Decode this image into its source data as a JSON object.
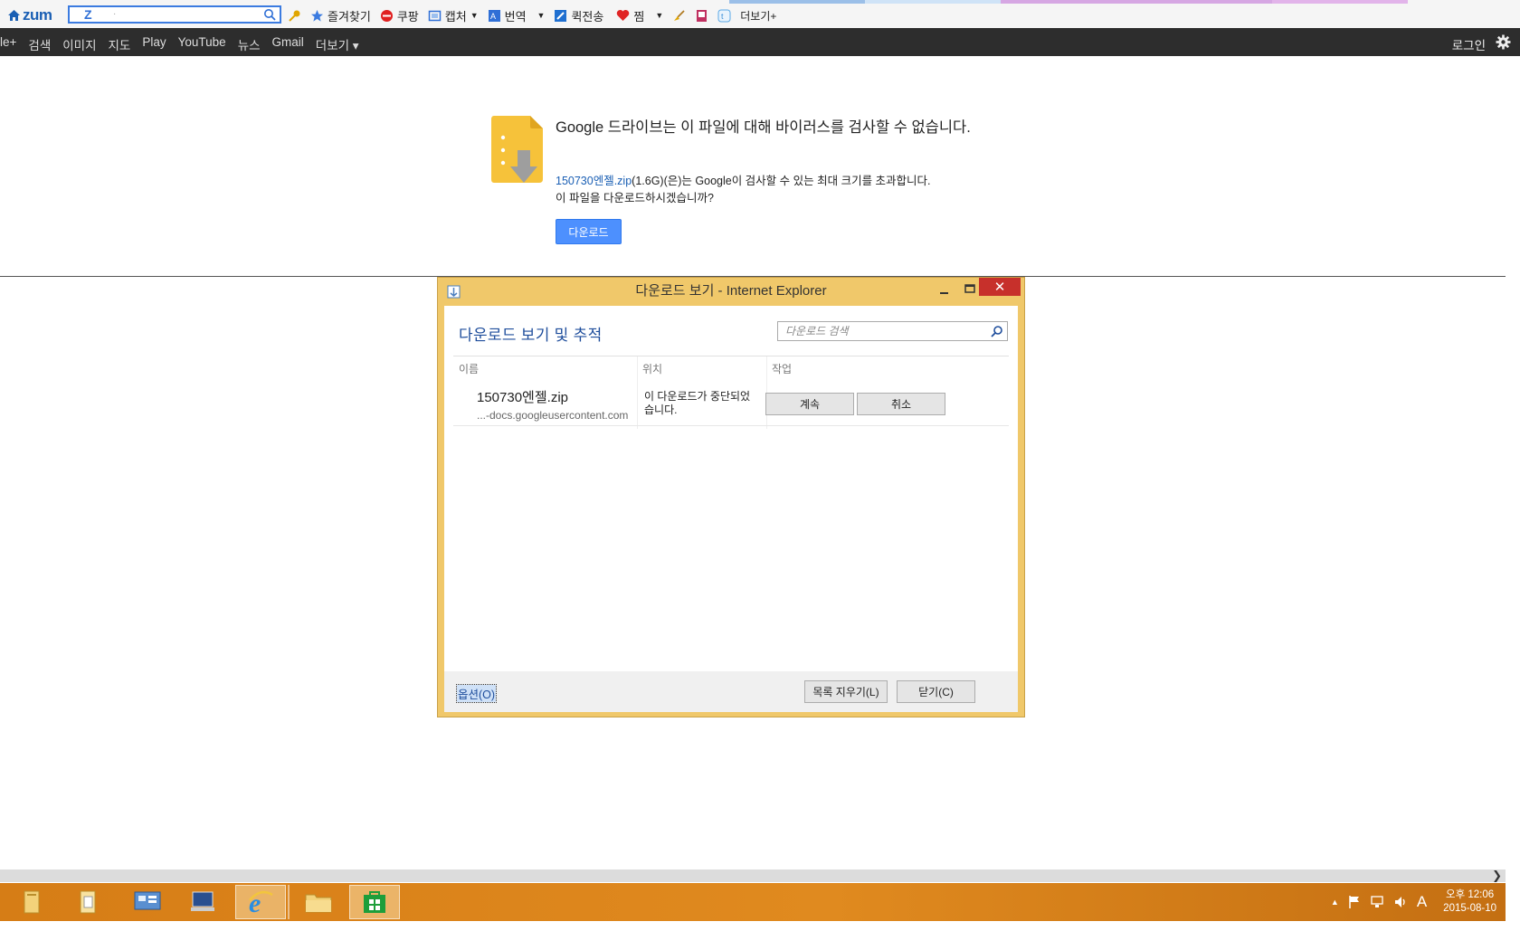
{
  "zum_toolbar": {
    "logo": "zum",
    "search_value": "·",
    "tools": [
      {
        "label": "즐겨찾기",
        "icon": "star-icon"
      },
      {
        "label": "쿠팡",
        "icon": "coupang-icon"
      },
      {
        "label": "캡처",
        "icon": "capture-icon"
      },
      {
        "label": "번역",
        "icon": "translate-icon"
      },
      {
        "label": "퀵전송",
        "icon": "quick-send-icon"
      },
      {
        "label": "찜",
        "icon": "heart-icon"
      }
    ],
    "more_label": "더보기+"
  },
  "google_bar": {
    "links": [
      "le+",
      "검색",
      "이미지",
      "지도",
      "Play",
      "YouTube",
      "뉴스",
      "Gmail",
      "더보기 ▾"
    ],
    "login_label": "로그인"
  },
  "drive_warning": {
    "title": "Google 드라이브는 이 파일에 대해 바이러스를 검사할 수 없습니다.",
    "file_name": "150730엔젤.zip",
    "desc_rest": "(1.6G)(은)는 Google이 검사할 수 있는 최대 크기를 초과합니다.",
    "question": "이 파일을 다운로드하시겠습니까?",
    "download_button": "다운로드"
  },
  "download_dialog": {
    "title": "다운로드 보기 - Internet Explorer",
    "close_glyph": "✕",
    "heading": "다운로드 보기 및 추적",
    "search_placeholder": "다운로드 검색",
    "columns": {
      "name": "이름",
      "location": "위치",
      "action": "작업"
    },
    "item": {
      "name": "150730엔젤.zip",
      "source": "...-docs.googleusercontent.com",
      "status": "이 다운로드가 중단되었습니다.",
      "resume_button": "계속",
      "cancel_button": "취소"
    },
    "options_link": "옵션(O)",
    "clear_list_button": "목록 지우기(L)",
    "close_button": "닫기(C)"
  },
  "taskbar": {
    "clock_time": "오후 12:06",
    "clock_date": "2015-08-10",
    "ime_label": "A"
  },
  "colors": {
    "accent_blue": "#4d90fe",
    "dialog_frame": "#f0c86a",
    "taskbar": "#e08a1f",
    "close_red": "#c7302b"
  }
}
